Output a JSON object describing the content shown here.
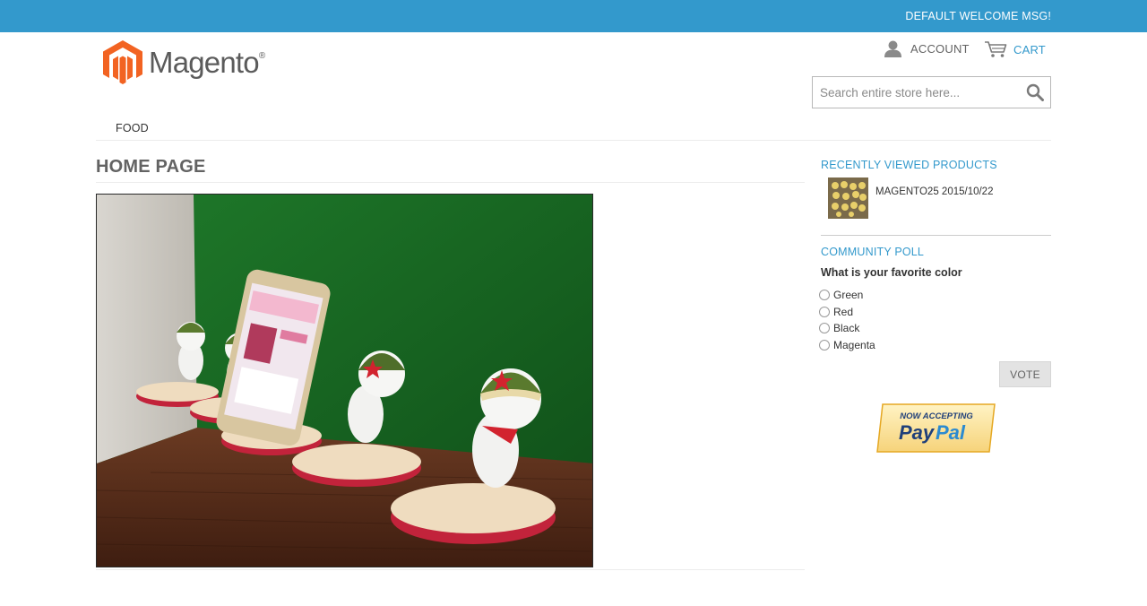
{
  "header": {
    "welcome_message": "DEFAULT WELCOME MSG!",
    "logo_text": "Magento",
    "logo_mark": "®",
    "account_label": "ACCOUNT",
    "cart_label": "CART",
    "search": {
      "placeholder": "Search entire store here...",
      "value": ""
    }
  },
  "nav": {
    "items": [
      {
        "label": "FOOD"
      }
    ]
  },
  "main": {
    "title": "HOME PAGE",
    "hero_image": "mi-bunny-phone-stands-photo"
  },
  "sidebar": {
    "recently_viewed": {
      "title": "RECENTLY VIEWED PRODUCTS",
      "items": [
        {
          "name": "MAGENTO25 2015/10/22"
        }
      ]
    },
    "poll": {
      "title": "COMMUNITY POLL",
      "question": "What is your favorite color",
      "options": [
        {
          "label": "Green"
        },
        {
          "label": "Red"
        },
        {
          "label": "Black"
        },
        {
          "label": "Magenta"
        }
      ],
      "vote_label": "VOTE"
    },
    "paypal": {
      "top_text": "NOW ACCEPTING",
      "brand_a": "Pay",
      "brand_b": "Pal"
    }
  },
  "colors": {
    "topbar": "#3399cc",
    "accent": "#3399cc",
    "logo_orange": "#f26322"
  },
  "icons": [
    "account-icon",
    "cart-icon",
    "search-icon",
    "magento-logo-icon"
  ]
}
